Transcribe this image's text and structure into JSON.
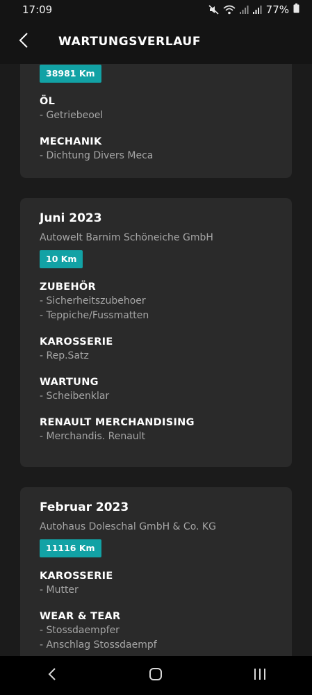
{
  "status_bar": {
    "time": "17:09",
    "battery": "77%"
  },
  "app_bar": {
    "title": "WARTUNGSVERLAUF"
  },
  "cards": [
    {
      "km": "38981 Km",
      "sections": [
        {
          "title": "ÖL",
          "items": [
            "- Getriebeoel"
          ]
        },
        {
          "title": "MECHANIK",
          "items": [
            "- Dichtung Divers Meca"
          ]
        }
      ]
    },
    {
      "date": "Juni 2023",
      "dealer": "Autowelt Barnim Schöneiche GmbH",
      "km": "10 Km",
      "sections": [
        {
          "title": "ZUBEHÖR",
          "items": [
            "- Sicherheitszubehoer",
            "- Teppiche/Fussmatten"
          ]
        },
        {
          "title": "KAROSSERIE",
          "items": [
            "- Rep.Satz"
          ]
        },
        {
          "title": "WARTUNG",
          "items": [
            "- Scheibenklar"
          ]
        },
        {
          "title": "RENAULT MERCHANDISING",
          "items": [
            "- Merchandis. Renault"
          ]
        }
      ]
    },
    {
      "date": "Februar 2023",
      "dealer": "Autohaus Doleschal GmbH & Co. KG",
      "km": "11116 Km",
      "sections": [
        {
          "title": "KAROSSERIE",
          "items": [
            "- Mutter"
          ]
        },
        {
          "title": "WEAR & TEAR",
          "items": [
            "- Stossdaempfer",
            "- Anschlag Stossdaempf"
          ]
        }
      ]
    }
  ],
  "icons": {
    "back": "chevron-left-icon",
    "nav_back": "nav-back-icon",
    "nav_home": "nav-home-icon",
    "nav_recents": "nav-recents-icon"
  },
  "colors": {
    "accent": "#12a2a5",
    "card": "#2a2a2a",
    "background": "#1b1b1b"
  }
}
